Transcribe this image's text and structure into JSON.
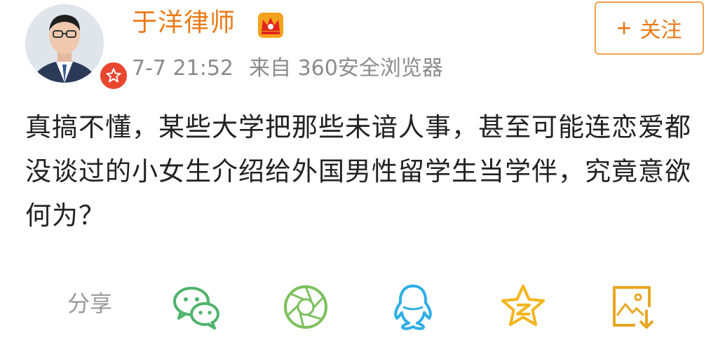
{
  "post": {
    "username": "于洋律师",
    "timestamp": "7-7 21:52",
    "source": "来自 360安全浏览器",
    "text": "真搞不懂，某些大学把那些未谙人事，甚至可能连恋爱都没谈过的小女生介绍给外国男性留学生当学伴，究竟意欲何为？"
  },
  "follow": {
    "plus": "+",
    "label": "关注"
  },
  "share": {
    "label": "分享",
    "icons": [
      "wechat-icon",
      "moments-icon",
      "qq-icon",
      "qzone-icon",
      "save-image-icon"
    ]
  },
  "colors": {
    "accent": "#e97a17",
    "verified": "#e8462f",
    "green": "#4fb36b",
    "qq_blue": "#2eaee6",
    "qzone_gold": "#f2b51d",
    "save_gold": "#e9a623"
  }
}
